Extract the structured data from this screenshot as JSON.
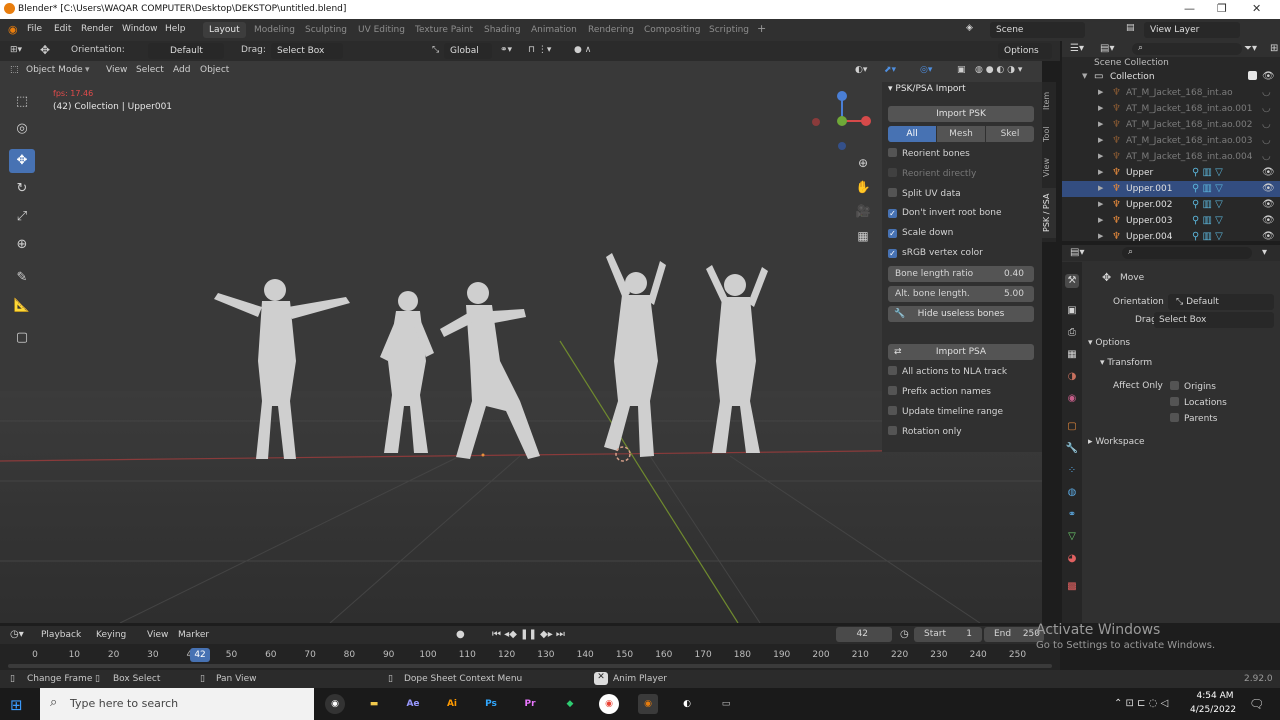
{
  "window": {
    "title": "Blender* [C:\\Users\\WAQAR COMPUTER\\Desktop\\DEKSTOP\\untitled.blend]"
  },
  "menubar": {
    "menus": [
      "File",
      "Edit",
      "Render",
      "Window",
      "Help"
    ],
    "workspaces": [
      "Layout",
      "Modeling",
      "Sculpting",
      "UV Editing",
      "Texture Paint",
      "Shading",
      "Animation",
      "Rendering",
      "Compositing",
      "Scripting"
    ],
    "active_workspace": "Layout",
    "add_tab": "+",
    "scene": "Scene",
    "view_layer": "View Layer"
  },
  "toolheader": {
    "orientation_label": "Orientation:",
    "orientation_value": "Default",
    "drag_label": "Drag:",
    "drag_value": "Select Box",
    "transform_orientation": "Global",
    "options": "Options"
  },
  "viewport": {
    "mode": "Object Mode",
    "menus": [
      "View",
      "Select",
      "Add",
      "Object"
    ],
    "fps": "fps: 17.46",
    "info": "(42) Collection | Upper001"
  },
  "npanel": {
    "tabs": [
      "Item",
      "Tool",
      "View",
      "PSK / PSA"
    ],
    "title": "PSK/PSA Import",
    "import_psk": "Import PSK",
    "filter": [
      "All",
      "Mesh",
      "Skel"
    ],
    "psk_options": [
      {
        "label": "Reorient bones",
        "checked": false,
        "dim": false
      },
      {
        "label": "Reorient directly",
        "checked": false,
        "dim": true
      },
      {
        "label": "Split UV data",
        "checked": false,
        "dim": false
      },
      {
        "label": "Don't invert root bone",
        "checked": true,
        "dim": false
      },
      {
        "label": "Scale down",
        "checked": true,
        "dim": false
      },
      {
        "label": "sRGB vertex color",
        "checked": true,
        "dim": false
      }
    ],
    "bone_length_ratio_label": "Bone length ratio",
    "bone_length_ratio": "0.40",
    "alt_bone_length_label": "Alt. bone length.",
    "alt_bone_length": "5.00",
    "hide_useless": "Hide useless bones",
    "import_psa": "Import PSA",
    "psa_options": [
      {
        "label": "All actions to NLA track",
        "checked": false
      },
      {
        "label": "Prefix action names",
        "checked": false
      },
      {
        "label": "Update timeline range",
        "checked": false
      },
      {
        "label": "Rotation only",
        "checked": false
      }
    ]
  },
  "outliner": {
    "scene_collection": "Scene Collection",
    "collection": "Collection",
    "items": [
      {
        "name": "AT_M_Jacket_168_int.ao",
        "dim": true
      },
      {
        "name": "AT_M_Jacket_168_int.ao.001",
        "dim": true
      },
      {
        "name": "AT_M_Jacket_168_int.ao.002",
        "dim": true
      },
      {
        "name": "AT_M_Jacket_168_int.ao.003",
        "dim": true
      },
      {
        "name": "AT_M_Jacket_168_int.ao.004",
        "dim": true
      },
      {
        "name": "Upper",
        "dim": false
      },
      {
        "name": "Upper.001",
        "dim": false
      },
      {
        "name": "Upper.002",
        "dim": false
      },
      {
        "name": "Upper.003",
        "dim": false
      },
      {
        "name": "Upper.004",
        "dim": false
      }
    ]
  },
  "properties": {
    "tool": "Move",
    "orientation_label": "Orientation",
    "orientation_value": "Default",
    "drag_label": "Drag:",
    "drag_value": "Select Box",
    "options": "Options",
    "transform": "Transform",
    "affect_only": "Affect Only",
    "affect_items": [
      "Origins",
      "Locations",
      "Parents"
    ],
    "workspace": "Workspace"
  },
  "timeline": {
    "menus": [
      "Playback",
      "Keying",
      "View",
      "Marker"
    ],
    "current_frame": "42",
    "start_label": "Start",
    "start": "1",
    "end_label": "End",
    "end": "250",
    "ticks": [
      "0",
      "10",
      "20",
      "30",
      "40",
      "50",
      "60",
      "70",
      "80",
      "90",
      "100",
      "110",
      "120",
      "130",
      "140",
      "150",
      "160",
      "170",
      "180",
      "190",
      "200",
      "210",
      "220",
      "230",
      "240",
      "250"
    ]
  },
  "statusbar": {
    "items": [
      "Change Frame",
      "Box Select",
      "Pan View",
      "Dope Sheet Context Menu"
    ],
    "anim_player": "Anim Player",
    "version": "2.92.0"
  },
  "watermark": {
    "title": "Activate Windows",
    "subtitle": "Go to Settings to activate Windows."
  },
  "taskbar": {
    "search_placeholder": "Type here to search",
    "apps": [
      {
        "name": "Ae",
        "color": "#1f1f5a",
        "fg": "#9999ff"
      },
      {
        "name": "Ai",
        "color": "#330000",
        "fg": "#ff9a00"
      },
      {
        "name": "Ps",
        "color": "#001e36",
        "fg": "#31a8ff"
      },
      {
        "name": "Pr",
        "color": "#2a003f",
        "fg": "#ea77ff"
      }
    ],
    "time": "4:54 AM",
    "date": "4/25/2022"
  }
}
